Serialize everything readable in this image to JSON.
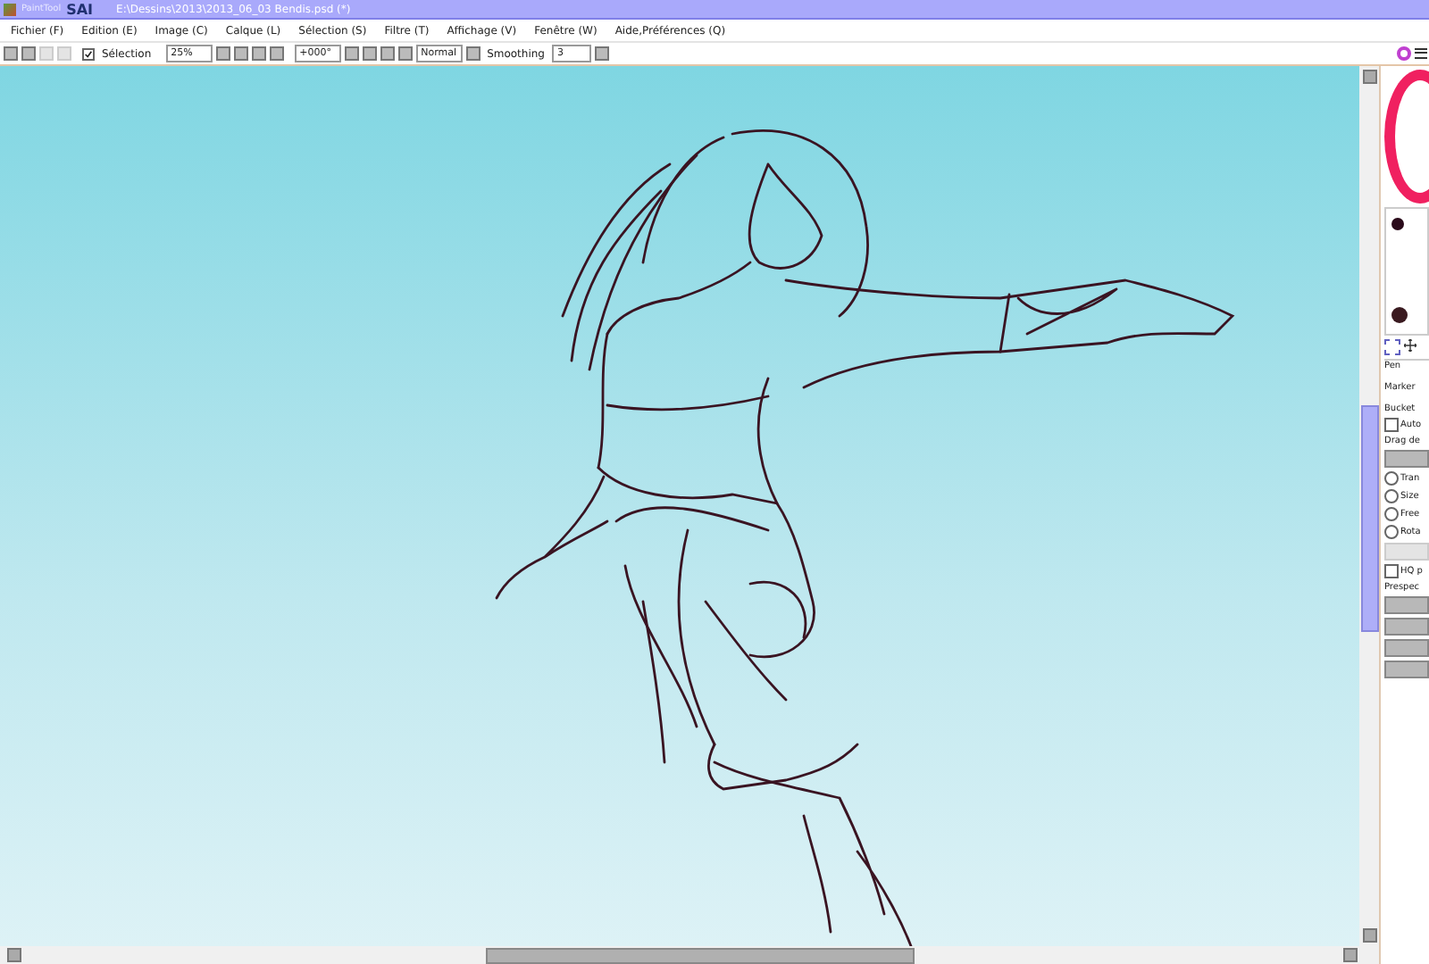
{
  "window": {
    "logo_prefix": "PaintTool",
    "logo_name": "SAI",
    "title": "E:\\Dessins\\2013\\2013_06_03 Bendis.psd (*)"
  },
  "menu": [
    "Fichier (F)",
    "Edition (E)",
    "Image (C)",
    "Calque (L)",
    "Sélection (S)",
    "Filtre (T)",
    "Affichage (V)",
    "Fenêtre (W)",
    "Aide,Préférences (Q)"
  ],
  "toolbar": {
    "selection": {
      "label": "Sélection",
      "checked": true
    },
    "zoom": "25%",
    "rotation": "+000°",
    "blend_mode": "Normal",
    "smoothing_label": "Smoothing",
    "smoothing_value": "3"
  },
  "tools": [
    "Pen",
    "Marker",
    "Bucket"
  ],
  "tool_options": {
    "auto": {
      "label": "Auto",
      "checked": false
    },
    "drag_label": "Drag de",
    "modes": [
      {
        "label": "Tran",
        "selected": false
      },
      {
        "label": "Size",
        "selected": false
      },
      {
        "label": "Free",
        "selected": false
      },
      {
        "label": "Rota",
        "selected": false
      }
    ],
    "hq": {
      "label": "HQ p",
      "checked": false
    },
    "perspective_label": "Prespec"
  }
}
